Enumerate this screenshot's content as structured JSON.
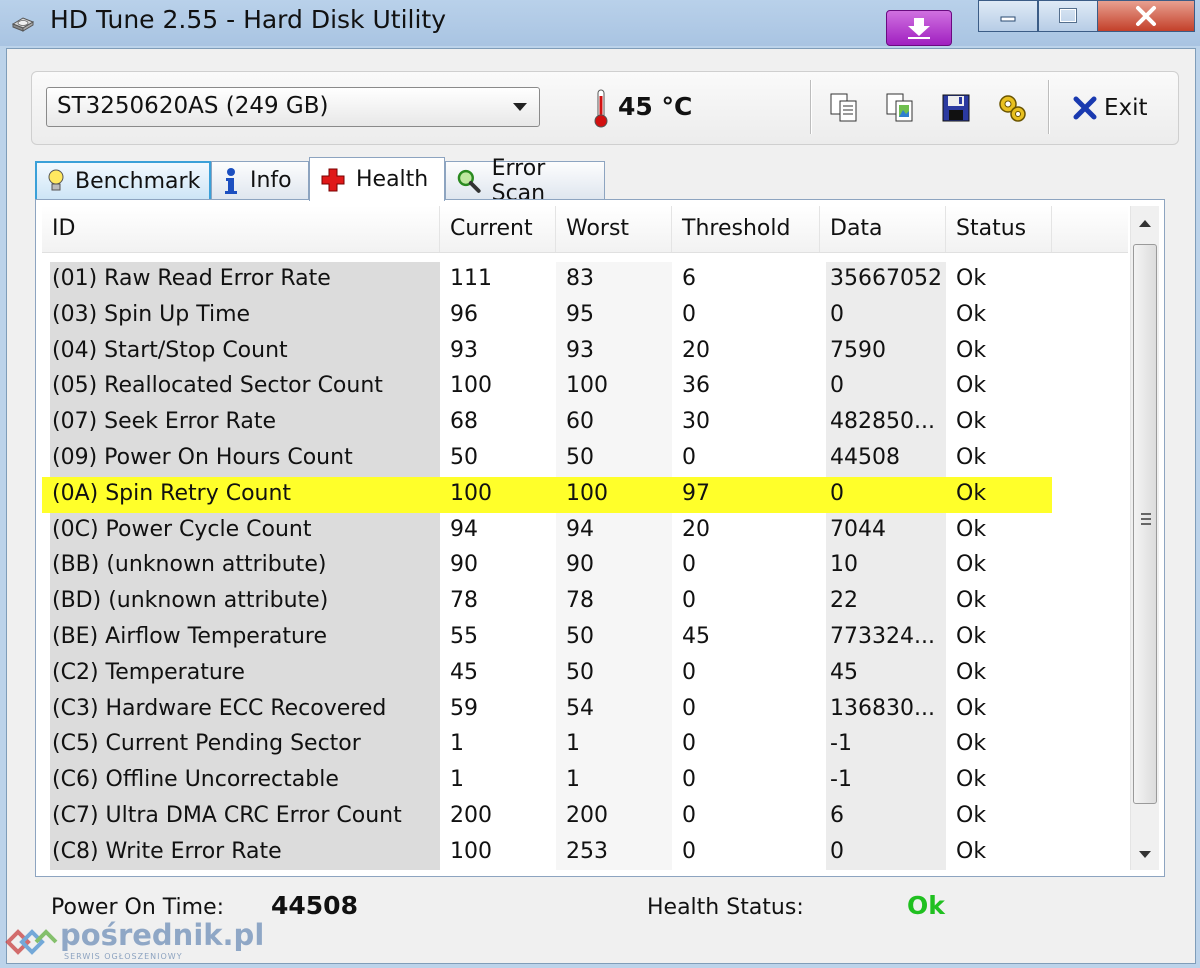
{
  "window": {
    "title": "HD Tune 2.55 - Hard Disk Utility"
  },
  "toolbar": {
    "drive": "ST3250620AS (249 GB)",
    "temperature": "45 °C",
    "exit_label": "Exit",
    "icons": [
      "copy-info-icon",
      "copy-screenshot-icon",
      "save-icon",
      "options-icon"
    ]
  },
  "tabs": [
    {
      "label": "Benchmark",
      "icon": "lightbulb-icon"
    },
    {
      "label": "Info",
      "icon": "info-icon"
    },
    {
      "label": "Health",
      "icon": "red-cross-icon",
      "active": true
    },
    {
      "label": "Error Scan",
      "icon": "magnifier-icon"
    }
  ],
  "table": {
    "columns": [
      "ID",
      "Current",
      "Worst",
      "Threshold",
      "Data",
      "Status"
    ],
    "rows": [
      [
        "(01) Raw Read Error Rate",
        "111",
        "83",
        "6",
        "35667052",
        "Ok"
      ],
      [
        "(03) Spin Up Time",
        "96",
        "95",
        "0",
        "0",
        "Ok"
      ],
      [
        "(04) Start/Stop Count",
        "93",
        "93",
        "20",
        "7590",
        "Ok"
      ],
      [
        "(05) Reallocated Sector Count",
        "100",
        "100",
        "36",
        "0",
        "Ok"
      ],
      [
        "(07) Seek Error Rate",
        "68",
        "60",
        "30",
        "482850...",
        "Ok"
      ],
      [
        "(09) Power On Hours Count",
        "50",
        "50",
        "0",
        "44508",
        "Ok"
      ],
      [
        "(0A) Spin Retry Count",
        "100",
        "100",
        "97",
        "0",
        "Ok"
      ],
      [
        "(0C) Power Cycle Count",
        "94",
        "94",
        "20",
        "7044",
        "Ok"
      ],
      [
        "(BB) (unknown attribute)",
        "90",
        "90",
        "0",
        "10",
        "Ok"
      ],
      [
        "(BD) (unknown attribute)",
        "78",
        "78",
        "0",
        "22",
        "Ok"
      ],
      [
        "(BE) Airflow Temperature",
        "55",
        "50",
        "45",
        "773324...",
        "Ok"
      ],
      [
        "(C2) Temperature",
        "45",
        "50",
        "0",
        "45",
        "Ok"
      ],
      [
        "(C3) Hardware ECC Recovered",
        "59",
        "54",
        "0",
        "136830...",
        "Ok"
      ],
      [
        "(C5) Current Pending Sector",
        "1",
        "1",
        "0",
        "-1",
        "Ok"
      ],
      [
        "(C6) Offline Uncorrectable",
        "1",
        "1",
        "0",
        "-1",
        "Ok"
      ],
      [
        "(C7) Ultra DMA CRC Error Count",
        "200",
        "200",
        "0",
        "6",
        "Ok"
      ],
      [
        "(C8) Write Error Rate",
        "100",
        "253",
        "0",
        "0",
        "Ok"
      ]
    ],
    "highlighted_row": 6,
    "highlight_color": "#ffff2a"
  },
  "footer": {
    "power_on_label": "Power On Time:",
    "power_on_value": "44508",
    "health_label": "Health Status:",
    "health_value": "Ok",
    "health_color": "#20c020"
  },
  "watermark": {
    "text": "pośrednik.pl",
    "subtext": "SERWIS OGŁOSZENIOWY"
  }
}
